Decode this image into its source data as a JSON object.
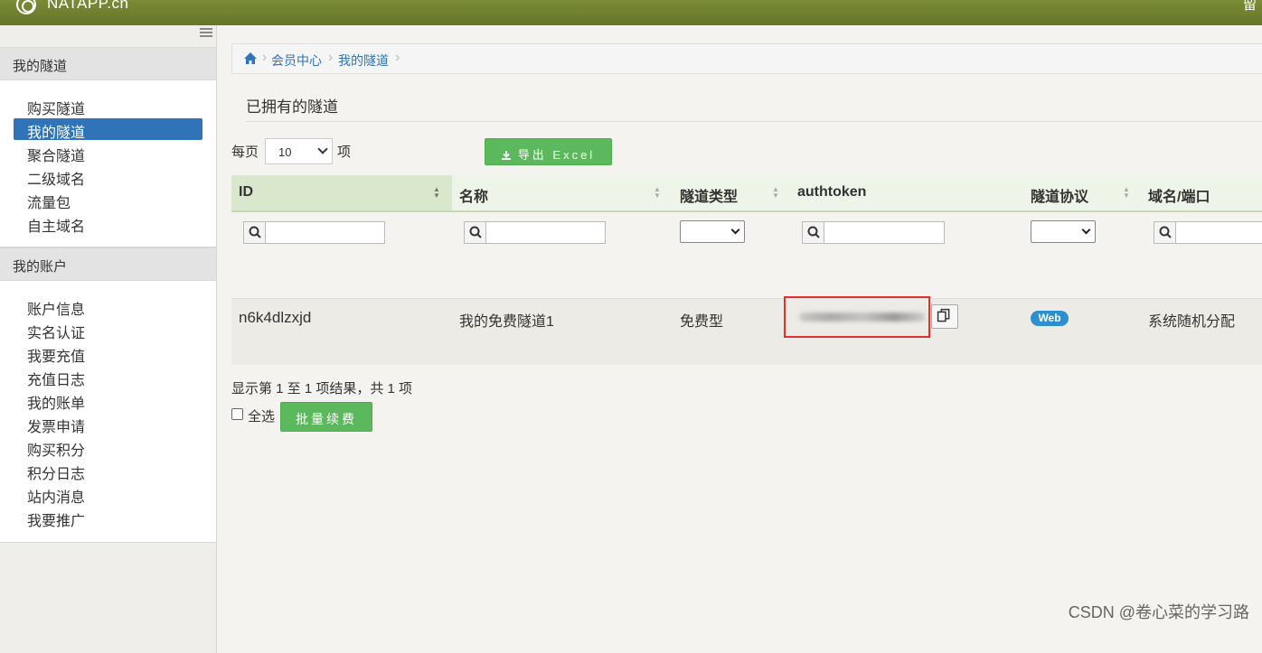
{
  "header": {
    "brand": "NATAPP.cn",
    "right_text": "留"
  },
  "sidebar": {
    "sections": [
      {
        "title": "我的隧道",
        "items": [
          "购买隧道",
          "我的隧道",
          "聚合隧道",
          "二级域名",
          "流量包",
          "自主域名"
        ],
        "active": "我的隧道"
      },
      {
        "title": "我的账户",
        "items": [
          "账户信息",
          "实名认证",
          "我要充值",
          "充值日志",
          "我的账单",
          "发票申请",
          "购买积分",
          "积分日志",
          "站内消息",
          "我要推广"
        ]
      }
    ]
  },
  "breadcrumb": [
    "会员中心",
    "我的隧道"
  ],
  "page_title": "已拥有的隧道",
  "pager": {
    "prefix": "每页",
    "value": "10",
    "suffix": "项"
  },
  "export_label": "导出 Excel",
  "table": {
    "columns": [
      "ID",
      "名称",
      "隧道类型",
      "authtoken",
      "隧道协议",
      "域名/端口"
    ],
    "rows": [
      {
        "id": "n6k4dlzxjd",
        "name": "我的免费隧道1",
        "type": "免费型",
        "authtoken": "",
        "protocol": "Web",
        "domain": "系统随机分配"
      }
    ]
  },
  "result_info": "显示第 1 至 1 项结果，共 1 项",
  "select_all_label": "全选",
  "renew_label": "批量续费",
  "watermark": "CSDN @卷心菜的学习路",
  "colors": {
    "header": "#6d7e30",
    "active": "#2f73b8",
    "button": "#5cb85c",
    "badge": "#2b8fd0",
    "highlight": "#e0312f"
  }
}
